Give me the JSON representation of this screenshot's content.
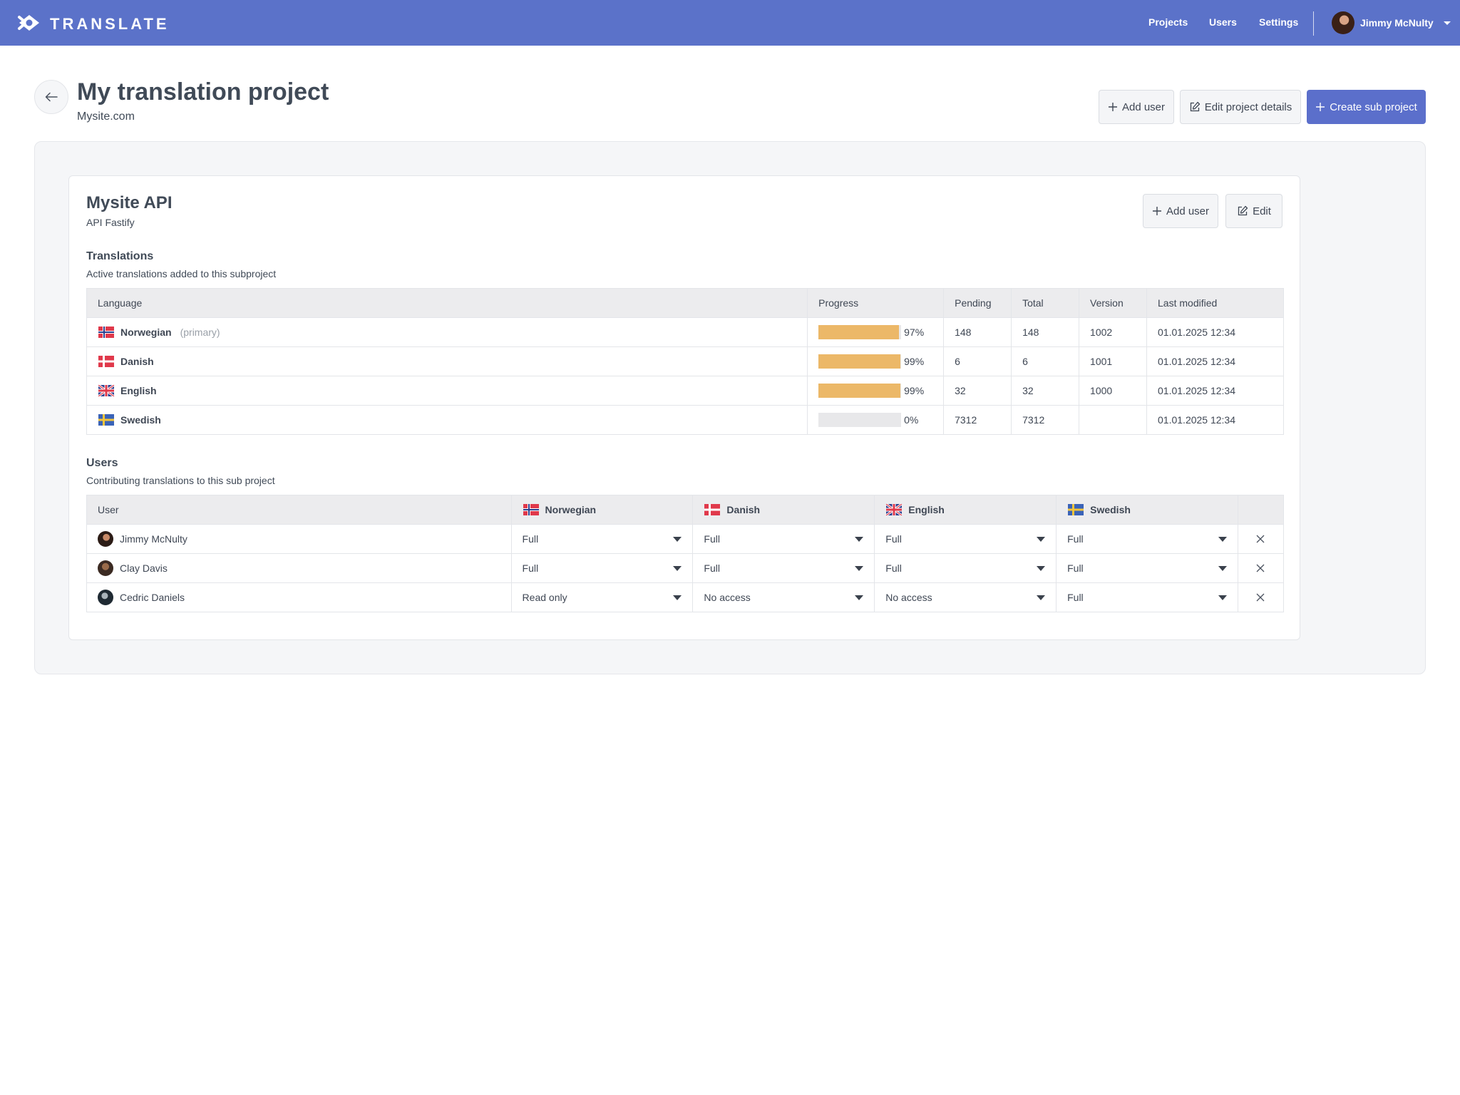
{
  "header": {
    "brand": "TRANSLATE",
    "nav": [
      "Projects",
      "Users",
      "Settings"
    ],
    "user_name": "Jimmy McNulty"
  },
  "page": {
    "title": "My translation project",
    "subtitle": "Mysite.com",
    "actions": {
      "add_user": "Add user",
      "edit_details": "Edit project details",
      "create_sub": "Create sub project"
    }
  },
  "subproject": {
    "title": "Mysite API",
    "subtitle": "API Fastify",
    "actions": {
      "add_user": "Add user",
      "edit": "Edit"
    },
    "translations": {
      "title": "Translations",
      "subtitle": "Active translations added to this subproject",
      "columns": [
        "Language",
        "Progress",
        "Pending",
        "Total",
        "Version",
        "Last modified"
      ],
      "rows": [
        {
          "flag": "norway-flag",
          "language": "Norwegian",
          "note": "(primary)",
          "progress": 0.97,
          "progress_label": "97%",
          "pending": "148",
          "total": "148",
          "version": "1002",
          "modified": "01.01.2025 12:34"
        },
        {
          "flag": "denmark-flag",
          "language": "Danish",
          "note": "",
          "progress": 0.99,
          "progress_label": "99%",
          "pending": "6",
          "total": "6",
          "version": "1001",
          "modified": "01.01.2025 12:34"
        },
        {
          "flag": "uk-flag",
          "language": "English",
          "note": "",
          "progress": 0.99,
          "progress_label": "99%",
          "pending": "32",
          "total": "32",
          "version": "1000",
          "modified": "01.01.2025 12:34"
        },
        {
          "flag": "sweden-flag",
          "language": "Swedish",
          "note": "",
          "progress": 0,
          "progress_label": "0%",
          "pending": "7312",
          "total": "7312",
          "version": "",
          "modified": "01.01.2025 12:34"
        }
      ]
    },
    "users": {
      "title": "Users",
      "subtitle": "Contributing translations to this sub project",
      "columns": [
        "User",
        "Norwegian",
        "Danish",
        "English",
        "Swedish"
      ],
      "rows": [
        {
          "name": "Jimmy McNulty",
          "access": [
            "Full",
            "Full",
            "Full",
            "Full"
          ]
        },
        {
          "name": "Clay Davis",
          "access": [
            "Full",
            "Full",
            "Full",
            "Full"
          ]
        },
        {
          "name": "Cedric Daniels",
          "access": [
            "Read only",
            "No access",
            "No access",
            "Full"
          ]
        }
      ]
    }
  },
  "colors": {
    "nav_bg": "#5b72c9",
    "primary_button": "#5b6fcb",
    "progress_fill": "#ecb868",
    "progress_track": "#e8e8ea"
  }
}
